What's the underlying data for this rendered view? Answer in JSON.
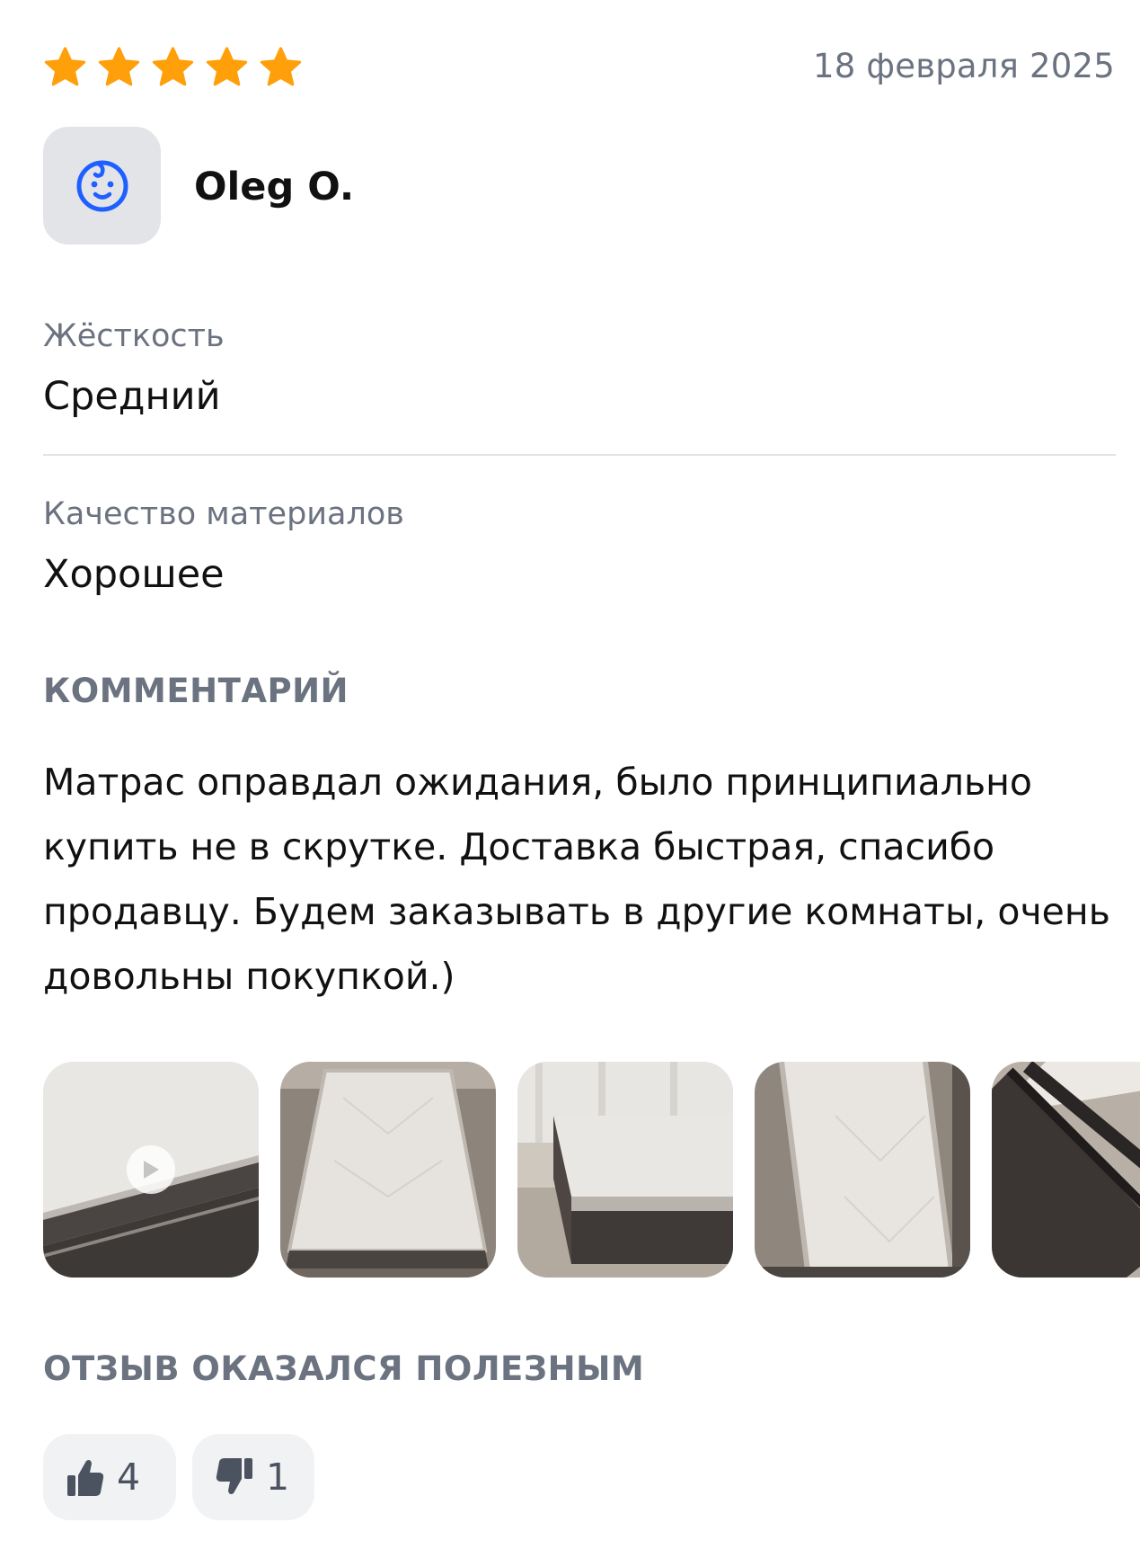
{
  "review": {
    "rating": 5,
    "date": "18 февраля 2025",
    "author": "Oleg O.",
    "avatar_icon": "baby-face-icon",
    "attributes": [
      {
        "label": "Жёсткость",
        "value": "Средний"
      },
      {
        "label": "Качество материалов",
        "value": "Хорошее"
      }
    ],
    "comment_title": "КОММЕНТАРИЙ",
    "comment": "Матрас оправдал ожидания, было принципиально купить не в скрутке. Доставка быстрая, спасибо продавцу. Будем заказывать в другие комнаты, очень довольны покупкой.)",
    "photos_count_visible": 5,
    "helpful_title": "ОТЗЫВ ОКАЗАЛСЯ ПОЛЕЗНЫМ",
    "likes": "4",
    "dislikes": "1"
  },
  "colors": {
    "star": "#ff9f0a",
    "avatar_icon": "#1f5fff",
    "muted_text": "#6b7280"
  }
}
